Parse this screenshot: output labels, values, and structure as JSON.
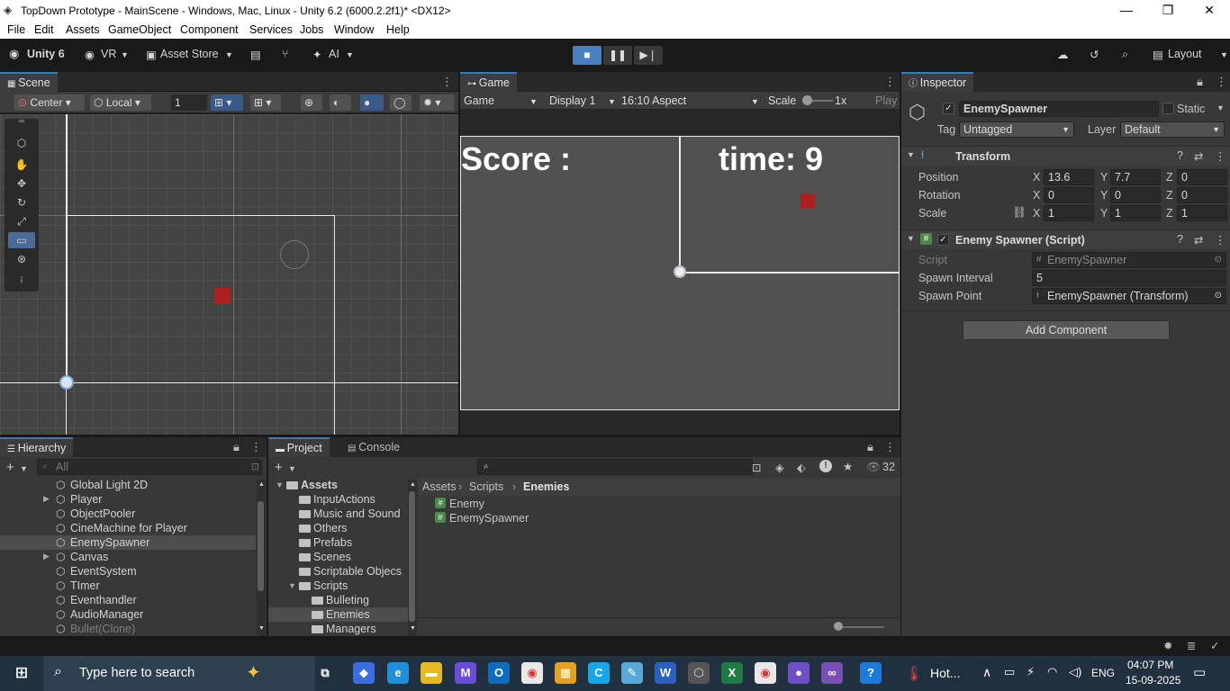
{
  "window": {
    "title": "TopDown Prototype - MainScene - Windows, Mac, Linux - Unity 6.2 (6000.2.2f1)* <DX12>",
    "controls": [
      "—",
      "❐",
      "✕"
    ]
  },
  "menu": [
    "File",
    "Edit",
    "Assets",
    "GameObject",
    "Component",
    "Services",
    "Jobs",
    "Window",
    "Help"
  ],
  "toolbar": {
    "unity_label": "Unity 6",
    "vr_label": "VR",
    "asset_store_label": "Asset Store",
    "ai_label": "AI",
    "layout_label": "Layout"
  },
  "scene": {
    "tab_label": "Scene",
    "pivot_label": "Center",
    "space_label": "Local",
    "grid_value": "1"
  },
  "game": {
    "tab_label": "Game",
    "mode_label": "Game",
    "display_label": "Display 1",
    "aspect_label": "16:10 Aspect",
    "scale_label": "Scale",
    "scale_value": "1x",
    "play_label": "Play",
    "score_text": "Score :",
    "time_text": "time: 9"
  },
  "inspector": {
    "tab_label": "Inspector",
    "object_name": "EnemySpawner",
    "static_label": "Static",
    "tag_label": "Tag",
    "tag_value": "Untagged",
    "layer_label": "Layer",
    "layer_value": "Default",
    "transform": {
      "title": "Transform",
      "position_label": "Position",
      "rotation_label": "Rotation",
      "scale_label": "Scale",
      "position": {
        "x": "13.6",
        "y": "7.7",
        "z": "0"
      },
      "rotation": {
        "x": "0",
        "y": "0",
        "z": "0"
      },
      "scale": {
        "x": "1",
        "y": "1",
        "z": "1"
      }
    },
    "script_component": {
      "title": "Enemy Spawner (Script)",
      "script_label": "Script",
      "script_value": "EnemySpawner",
      "interval_label": "Spawn Interval",
      "interval_value": "5",
      "point_label": "Spawn Point",
      "point_value": "EnemySpawner (Transform)"
    },
    "add_component_label": "Add Component"
  },
  "hierarchy": {
    "tab_label": "Hierarchy",
    "search_placeholder": "All",
    "items": [
      {
        "label": "Global Light 2D",
        "arrow": ""
      },
      {
        "label": "Player",
        "arrow": "▶"
      },
      {
        "label": "ObjectPooler",
        "arrow": ""
      },
      {
        "label": "CineMachine for Player",
        "arrow": ""
      },
      {
        "label": "EnemySpawner",
        "arrow": ""
      },
      {
        "label": "Canvas",
        "arrow": "▶"
      },
      {
        "label": "EventSystem",
        "arrow": ""
      },
      {
        "label": "TImer",
        "arrow": ""
      },
      {
        "label": "Eventhandler",
        "arrow": ""
      },
      {
        "label": "AudioManager",
        "arrow": ""
      },
      {
        "label": "Bullet(Clone)",
        "arrow": ""
      }
    ]
  },
  "project": {
    "tab_label": "Project",
    "console_label": "Console",
    "count": "32",
    "tree": [
      {
        "label": "Assets"
      },
      {
        "label": "InputActions"
      },
      {
        "label": "Music and Sound"
      },
      {
        "label": "Others"
      },
      {
        "label": "Prefabs"
      },
      {
        "label": "Scenes"
      },
      {
        "label": "Scriptable Objecs"
      },
      {
        "label": "Scripts"
      },
      {
        "label": "Bulleting"
      },
      {
        "label": "Enemies"
      },
      {
        "label": "Managers"
      }
    ],
    "breadcrumb": [
      "Assets",
      "Scripts",
      "Enemies"
    ],
    "files": [
      "Enemy",
      "EnemySpawner"
    ]
  },
  "taskbar": {
    "search_placeholder": "Type here to search",
    "weather": "Hot...",
    "lang": "ENG",
    "time": "04:07 PM",
    "date": "15-09-2025"
  }
}
